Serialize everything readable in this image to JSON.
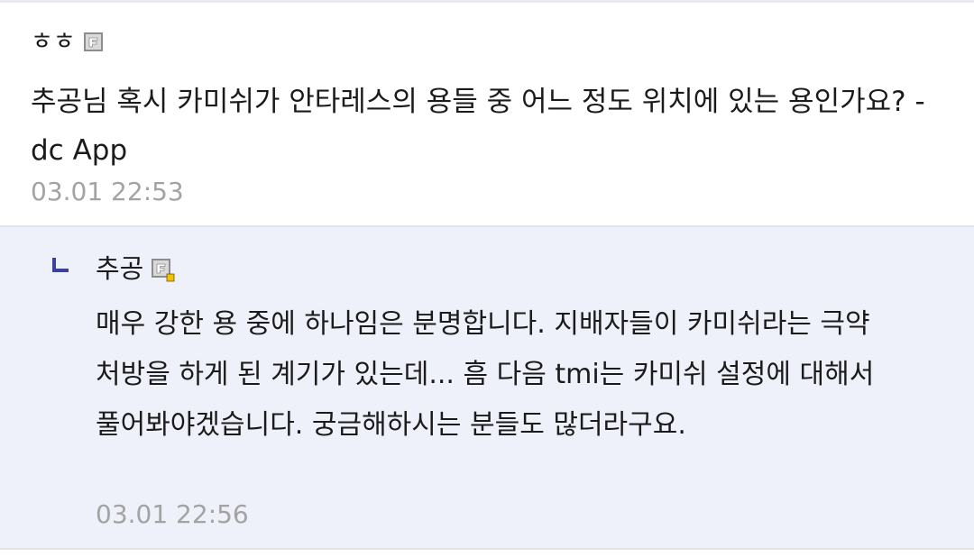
{
  "comment": {
    "author": "ㅎㅎ",
    "author_icon": "gallog-icon",
    "text": "추공님 혹시 카미쉬가 안타레스의 용들 중 어느 정도 위치에 있는 용인가요? - dc App",
    "date": "03.01 22:53"
  },
  "reply": {
    "marker_icon": "reply-arrow-icon",
    "author": "추공",
    "author_icon": "gallog-fixed-icon",
    "text": "매우 강한 용 중에 하나임은 분명합니다. 지배자들이 카미쉬라는 극약 처방을 하게 된 계기가 있는데... 흠 다음 tmi는 카미쉬 설정에 대해서 풀어봐야겠습니다. 궁금해하시는 분들도 많더라구요.",
    "date": "03.01 22:56"
  },
  "colors": {
    "reply_background": "#eef0fa",
    "date_text": "#a3a3a3",
    "reply_marker": "#3b3f9e",
    "fixed_badge": "#f2c200"
  }
}
